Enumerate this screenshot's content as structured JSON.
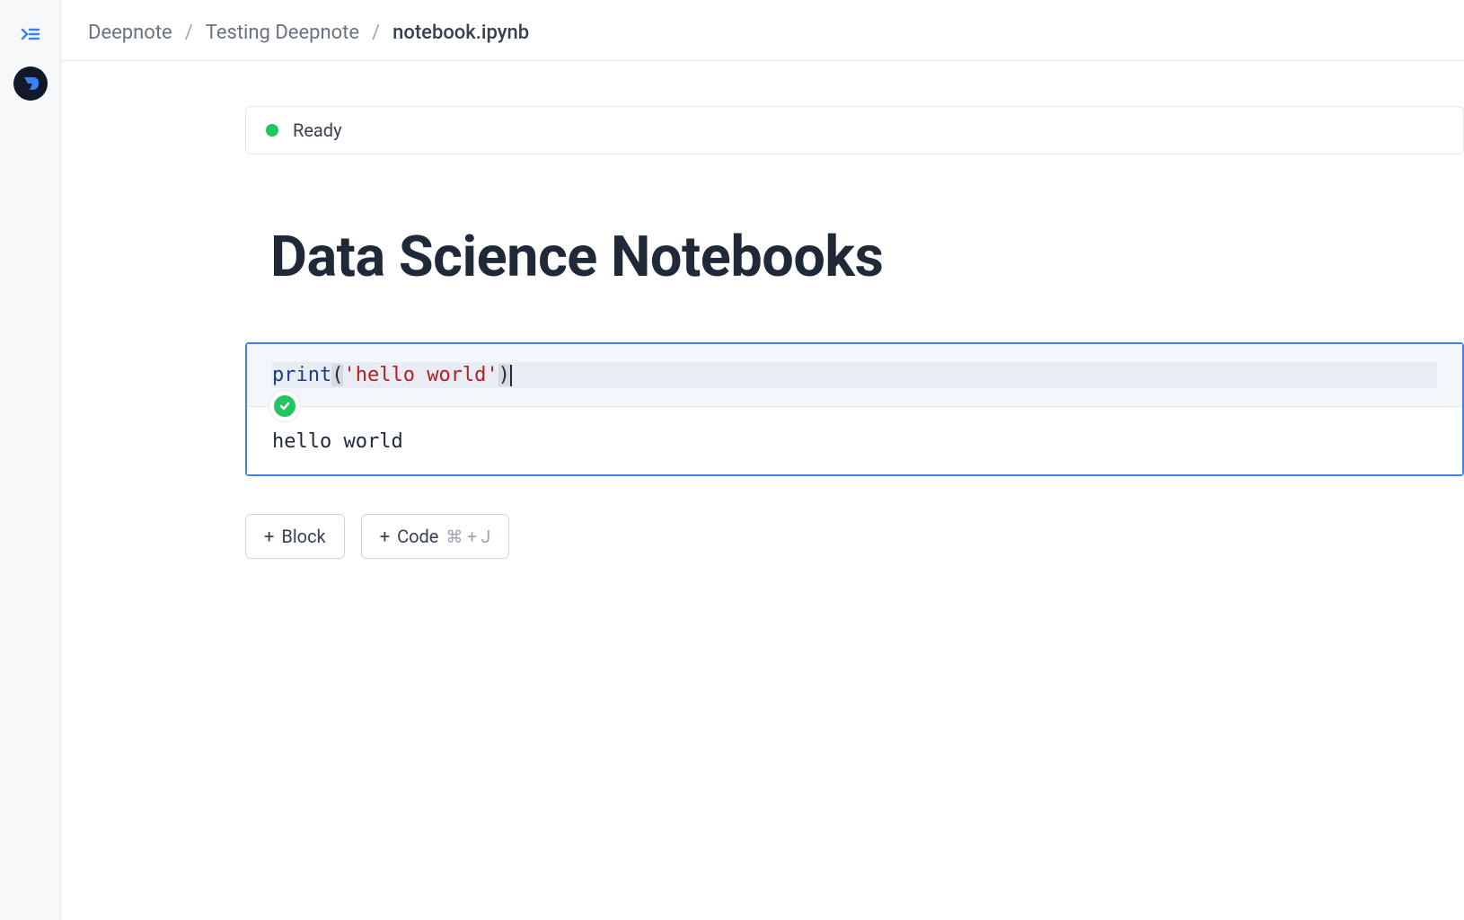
{
  "breadcrumbs": {
    "root": "Deepnote",
    "project": "Testing Deepnote",
    "current": "notebook.ipynb"
  },
  "status": {
    "label": "Ready",
    "color": "#22c55e"
  },
  "notebook": {
    "title": "Data Science Notebooks"
  },
  "cell": {
    "code": {
      "fn": "print",
      "paren_open": "(",
      "string": "'hello world'",
      "paren_close": ")"
    },
    "output": "hello world",
    "status_icon": "check-icon"
  },
  "actions": {
    "block": {
      "plus": "+",
      "label": "Block"
    },
    "code": {
      "plus": "+",
      "label": "Code",
      "shortcut": "⌘ + J"
    }
  },
  "sidebar": {
    "toggle_icon": "sidebar-toggle-icon",
    "logo_icon": "deepnote-logo-icon"
  }
}
